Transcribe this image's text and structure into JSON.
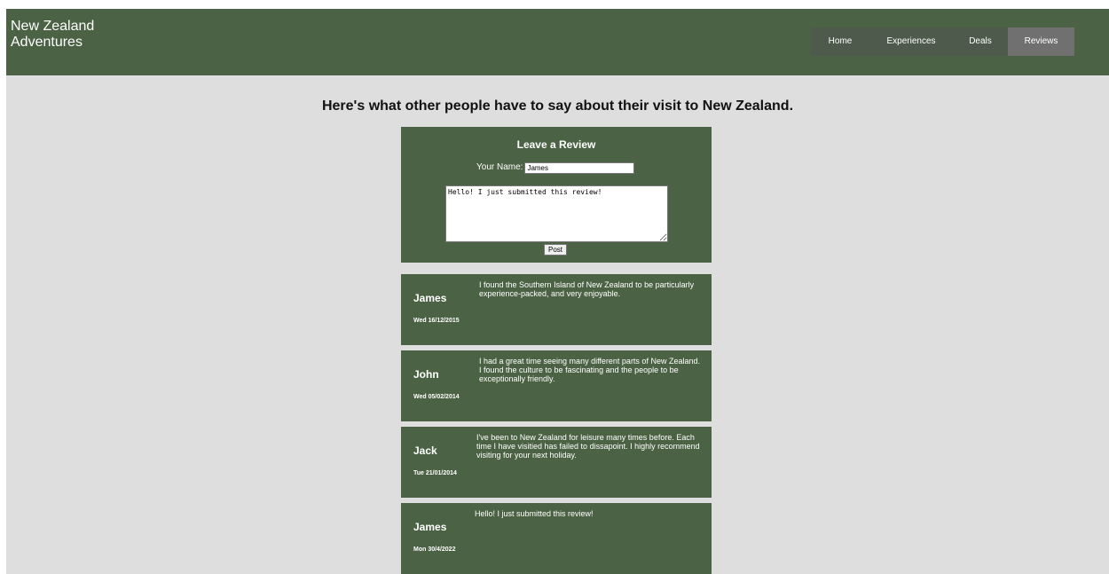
{
  "header": {
    "site_title": "New Zealand Adventures",
    "nav": [
      {
        "label": "Home"
      },
      {
        "label": "Experiences"
      },
      {
        "label": "Deals"
      },
      {
        "label": "Reviews",
        "active": true
      }
    ]
  },
  "main": {
    "headline": "Here's what other people have to say about their visit to New Zealand.",
    "form": {
      "title": "Leave a Review",
      "name_label": "Your Name:",
      "name_value": "James",
      "review_text": "Hello! I just submitted this review!",
      "post_label": "Post"
    },
    "reviews": [
      {
        "name": "James",
        "date": "Wed 16/12/2015",
        "text": "I found the Southern Island of New Zealand to be particularly experience-packed, and very enjoyable."
      },
      {
        "name": "John",
        "date": "Wed 05/02/2014",
        "text": "I had a great time seeing many different parts of New Zealand. I found the culture to be fascinating and the people to be exceptionally friendly."
      },
      {
        "name": "Jack",
        "date": "Tue 21/01/2014",
        "text": "I've been to New Zealand for leisure many times before. Each time I have visitied has failed to dissapoint. I highly recommend visiting for your next holiday."
      },
      {
        "name": "James",
        "date": "Mon 30/4/2022",
        "text": "Hello! I just submitted this review!"
      }
    ]
  },
  "colors": {
    "header_bg": "#4b6244",
    "page_bg": "#dedede",
    "nav_bg": "#4e5a4c",
    "nav_active_bg": "#707070",
    "card_bg": "#4b6244"
  }
}
